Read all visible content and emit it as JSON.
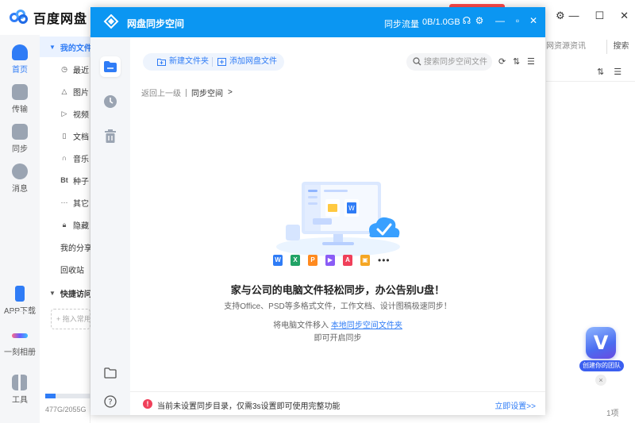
{
  "app": {
    "title": "百度网盘",
    "window_controls": [
      "—",
      "☐",
      "✕"
    ],
    "rail": [
      {
        "label": "首页",
        "icon": "cloud-icon"
      },
      {
        "label": "传输",
        "icon": "transfer-icon"
      },
      {
        "label": "同步",
        "icon": "sync-icon"
      },
      {
        "label": "消息",
        "icon": "message-icon"
      },
      {
        "label": "APP下载",
        "icon": "phone-icon"
      },
      {
        "label": "一刻相册",
        "icon": "album-icon"
      },
      {
        "label": "工具",
        "icon": "tools-icon"
      }
    ],
    "sidebar": {
      "my_files": "我的文件",
      "items": [
        "最近",
        "图片",
        "视频",
        "文档",
        "音乐",
        "种子",
        "其它",
        "隐藏"
      ],
      "my_share": "我的分享",
      "recycle": "回收站",
      "quick_access": "快捷访问",
      "drop_hint": "拖入常用"
    },
    "storage": {
      "text": "477G/2055G",
      "used_fraction": 0.23
    },
    "right": {
      "search_tab": "网资源资讯",
      "search_button": "搜索",
      "count": "1项"
    },
    "promo": {
      "label": "创建你的团队",
      "badge": "V"
    }
  },
  "dialog": {
    "title": "网盘同步空间",
    "quota_label": "同步流量",
    "quota_value": "0B/1.0GB",
    "toolbar": {
      "new_folder": "新建文件夹",
      "add_files": "添加网盘文件"
    },
    "search": {
      "placeholder": "搜索同步空间文件"
    },
    "breadcrumb": {
      "back": "返回上一级",
      "current": "同步空间",
      "arrow": ">"
    },
    "empty": {
      "headline": "家与公司的电脑文件轻松同步，办公告别U盘！",
      "sub": "支持Office、PSD等多格式文件，工作文档、设计图稿极速同步！",
      "hint_prefix": "将电脑文件移入",
      "hint_link": "本地同步空间文件夹",
      "hint_suffix": "即可开启同步",
      "file_types": [
        {
          "letter": "W",
          "color": "#2f7cf6"
        },
        {
          "letter": "X",
          "color": "#21a366"
        },
        {
          "letter": "P",
          "color": "#ff8a1f"
        },
        {
          "letter": "▶",
          "color": "#8a5cf6"
        },
        {
          "letter": "A",
          "color": "#f0405a"
        },
        {
          "letter": "▣",
          "color": "#f5a623"
        }
      ],
      "more": "•••"
    },
    "footer": {
      "warning": "当前未设置同步目录，仅需3s设置即可使用完整功能",
      "action": "立即设置>>"
    }
  }
}
